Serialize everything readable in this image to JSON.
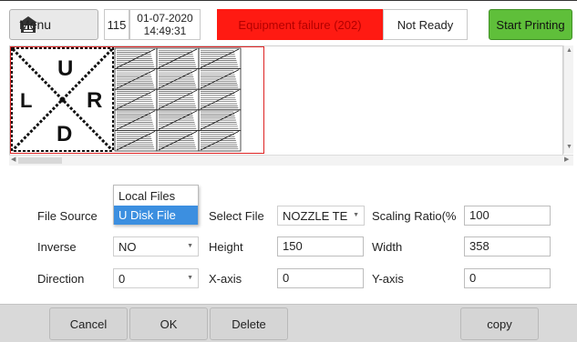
{
  "header": {
    "menu_label": "Menu",
    "counter": "115",
    "date": "01-07-2020",
    "time": "14:49:31",
    "alarm_text": "Equipment failure (202)",
    "status_text": "Not Ready",
    "start_label": "Start Printing"
  },
  "preview": {
    "letters": {
      "up": "U",
      "left": "L",
      "right": "R",
      "down": "D"
    }
  },
  "form": {
    "file_source_label": "File Source",
    "file_source_options": [
      "Local Files",
      "U Disk File"
    ],
    "file_source_selected": "U Disk File",
    "select_file_label": "Select File",
    "select_file_value": "NOZZLE TE",
    "scaling_label": "Scaling Ratio(%",
    "scaling_value": "100",
    "inverse_label": "Inverse",
    "inverse_value": "NO",
    "height_label": "Height",
    "height_value": "150",
    "width_label": "Width",
    "width_value": "358",
    "direction_label": "Direction",
    "direction_value": "0",
    "xaxis_label": "X-axis",
    "xaxis_value": "0",
    "yaxis_label": "Y-axis",
    "yaxis_value": "0"
  },
  "toolbar": {
    "cancel_label": "Cancel",
    "ok_label": "OK",
    "delete_label": "Delete",
    "copy_label": "copy"
  },
  "colors": {
    "alarm": "#ff1a12",
    "start": "#5fbf3a",
    "selection": "#3c8fe0"
  }
}
